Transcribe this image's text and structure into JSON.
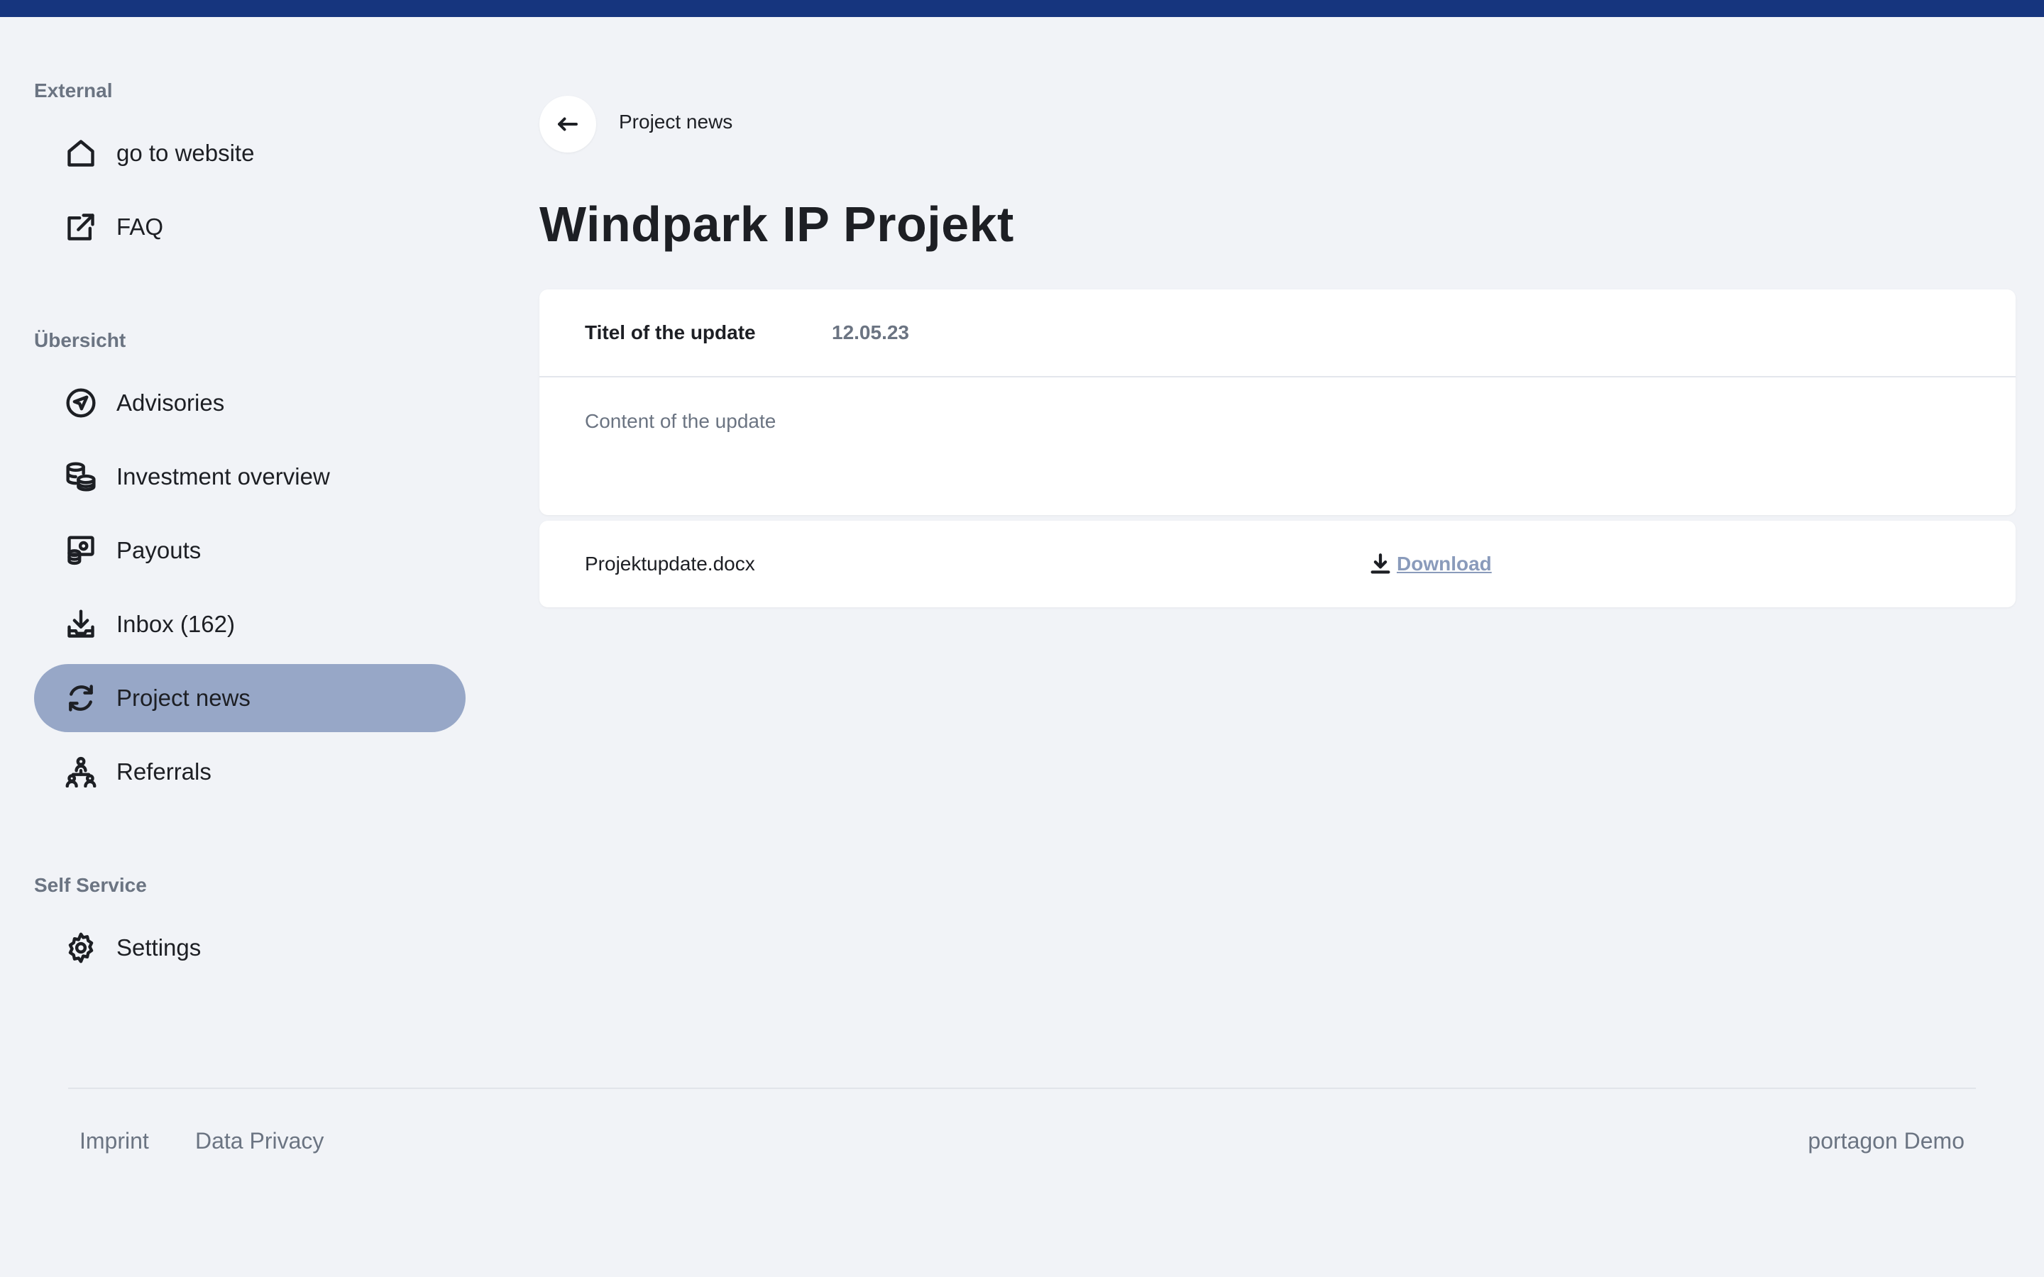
{
  "sidebar": {
    "sections": [
      {
        "label": "External"
      },
      {
        "label": "Übersicht"
      },
      {
        "label": "Self Service"
      }
    ],
    "items": [
      {
        "label": "go to website",
        "icon": "home-icon"
      },
      {
        "label": "FAQ",
        "icon": "external-link-icon"
      },
      {
        "label": "Advisories",
        "icon": "send-icon"
      },
      {
        "label": "Investment overview",
        "icon": "coins-icon"
      },
      {
        "label": "Payouts",
        "icon": "payout-icon"
      },
      {
        "label": "Inbox (162)",
        "icon": "inbox-download-icon"
      },
      {
        "label": "Project news",
        "icon": "refresh-icon",
        "active": true
      },
      {
        "label": "Referrals",
        "icon": "referrals-icon"
      },
      {
        "label": "Settings",
        "icon": "gear-icon"
      }
    ]
  },
  "header": {
    "breadcrumb": "Project news",
    "title": "Windpark IP Projekt"
  },
  "update": {
    "title": "Titel of the update",
    "date": "12.05.23",
    "content": "Content of the update"
  },
  "attachment": {
    "file_name": "Projektupdate.docx",
    "download_label": "Download"
  },
  "footer": {
    "links": [
      "Imprint",
      "Data Privacy"
    ],
    "brand": "portagon Demo"
  },
  "colors": {
    "topbar": "#16357e",
    "active_nav": "#97a7c7",
    "background": "#f1f3f7",
    "download_link": "#8a9bbb"
  }
}
